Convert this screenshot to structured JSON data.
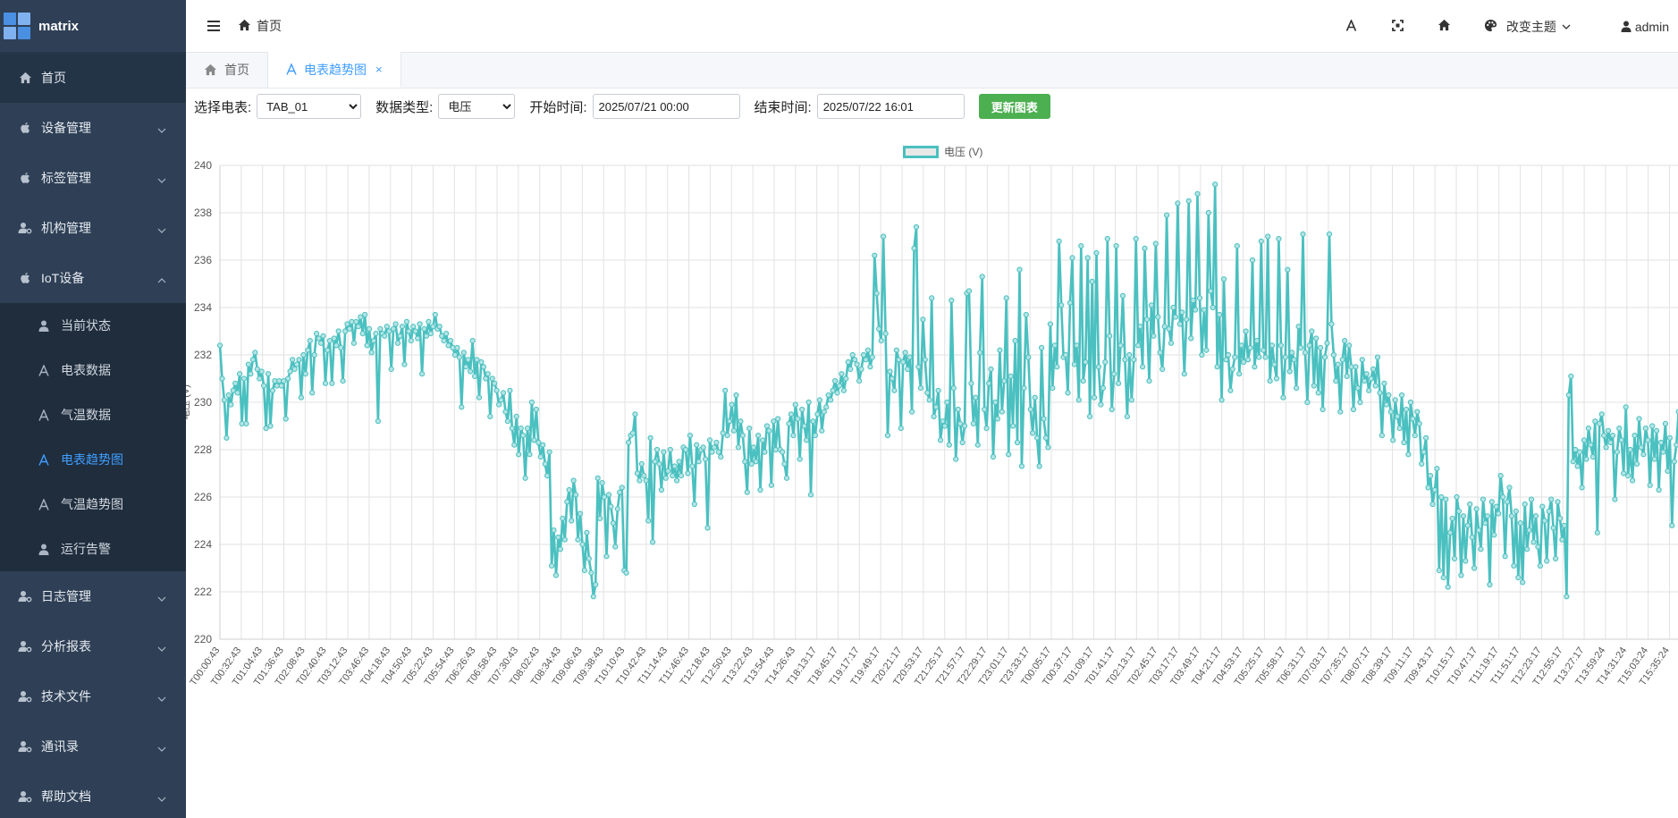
{
  "app": {
    "brand": "matrix"
  },
  "sidebar": {
    "items": [
      {
        "label": "首页",
        "icon": "home-icon"
      },
      {
        "label": "设备管理",
        "icon": "apple-icon"
      },
      {
        "label": "标签管理",
        "icon": "apple-icon"
      },
      {
        "label": "机构管理",
        "icon": "user-gear-icon"
      },
      {
        "label": "IoT设备",
        "icon": "apple-icon"
      },
      {
        "label": "日志管理",
        "icon": "user-gear-icon"
      },
      {
        "label": "分析报表",
        "icon": "user-gear-icon"
      },
      {
        "label": "技术文件",
        "icon": "user-gear-icon"
      },
      {
        "label": "通讯录",
        "icon": "user-gear-icon"
      },
      {
        "label": "帮助文档",
        "icon": "user-gear-icon"
      }
    ],
    "iot_sub": [
      {
        "label": "当前状态",
        "icon": "user-icon"
      },
      {
        "label": "电表数据",
        "icon": "font-icon"
      },
      {
        "label": "气温数据",
        "icon": "font-icon"
      },
      {
        "label": "电表趋势图",
        "icon": "font-icon"
      },
      {
        "label": "气温趋势图",
        "icon": "font-icon"
      },
      {
        "label": "运行告警",
        "icon": "user-icon"
      }
    ]
  },
  "header": {
    "breadcrumb": "首页",
    "theme_label": "改变主题",
    "user": "admin"
  },
  "tabs": [
    {
      "label": "首页"
    },
    {
      "label": "电表趋势图",
      "close": "×"
    }
  ],
  "toolbar": {
    "meter_label": "选择电表:",
    "meter_value": "TAB_01",
    "type_label": "数据类型:",
    "type_value": "电压",
    "start_label": "开始时间:",
    "start_value": "2025/07/21 00:00",
    "end_label": "结束时间:",
    "end_value": "2025/07/22 16:01",
    "update_button": "更新图表"
  },
  "colors": {
    "sidebar_bg": "#2f4056",
    "accent": "#409eff",
    "series": "#4bc0c0",
    "button": "#4caf50"
  },
  "chart_data": {
    "type": "line",
    "legend": "电压 (V)",
    "ylabel": "电压 (V)",
    "ylim": [
      220,
      240
    ],
    "yticks": [
      220,
      222,
      224,
      226,
      228,
      230,
      232,
      234,
      236,
      238,
      240
    ],
    "xticks": [
      "T00:00:43",
      "T00:32:43",
      "T01:04:43",
      "T01:36:43",
      "T02:08:43",
      "T02:40:43",
      "T03:12:43",
      "T03:46:43",
      "T04:18:43",
      "T04:50:43",
      "T05:22:43",
      "T05:54:43",
      "T06:26:43",
      "T06:58:43",
      "T07:30:43",
      "T08:02:43",
      "T08:34:43",
      "T09:06:43",
      "T09:38:43",
      "T10:10:43",
      "T10:42:43",
      "T11:14:43",
      "T11:46:43",
      "T12:18:43",
      "T12:50:43",
      "T13:22:43",
      "T13:54:43",
      "T14:26:43",
      "T18:13:17",
      "T18:45:17",
      "T19:17:17",
      "T19:49:17",
      "T20:21:17",
      "T20:53:17",
      "T21:25:17",
      "T21:57:17",
      "T22:29:17",
      "T23:01:17",
      "T23:33:17",
      "T00:05:17",
      "T00:37:17",
      "T01:09:17",
      "T01:41:17",
      "T02:13:17",
      "T02:45:17",
      "T03:17:17",
      "T03:49:17",
      "T04:21:17",
      "T04:53:17",
      "T05:25:17",
      "T05:58:17",
      "T06:31:17",
      "T07:03:17",
      "T07:35:17",
      "T08:07:17",
      "T08:39:17",
      "T09:11:17",
      "T09:43:17",
      "T10:15:17",
      "T10:47:17",
      "T11:19:17",
      "T11:51:17",
      "T12:23:17",
      "T12:55:17",
      "T13:27:17",
      "T13:59:24",
      "T14:31:24",
      "T15:03:24",
      "T15:35:24"
    ],
    "series": [
      {
        "name": "电压 (V)",
        "values": [
          232.4,
          231.0,
          230.1,
          228.5,
          230.3,
          229.9,
          230.5,
          230.8,
          230.4,
          231.2,
          229.1,
          231.0,
          229.1,
          231.6,
          231.2,
          231.8,
          232.1,
          231.4,
          231.0,
          231.3,
          230.7,
          228.9,
          231.2,
          229.0,
          230.5,
          230.9,
          230.7,
          230.9,
          230.7,
          230.9,
          229.3,
          231.0,
          231.3,
          231.8,
          231.4,
          231.6,
          231.8,
          230.2,
          232.0,
          231.2,
          232.2,
          232.6,
          230.4,
          232.0,
          232.9,
          232.7,
          232.5,
          232.8,
          230.8,
          232.2,
          232.6,
          230.8,
          232.7,
          232.4,
          233.0,
          232.3,
          230.9,
          233.0,
          233.3,
          233.1,
          233.4,
          232.5,
          233.4,
          233.2,
          233.6,
          232.9,
          233.7,
          232.4,
          233.1,
          232.1,
          232.6,
          232.9,
          229.2,
          233.1,
          232.9,
          232.8,
          233.2,
          233.0,
          231.4,
          233.1,
          233.3,
          232.5,
          232.8,
          233.2,
          231.6,
          233.4,
          233.0,
          232.6,
          233.2,
          233.0,
          232.7,
          233.3,
          231.2,
          233.1,
          232.8,
          233.4,
          232.9,
          233.2,
          233.7,
          233.1,
          233.2,
          232.8,
          232.6,
          232.9,
          232.4,
          232.6,
          232.3,
          232.0,
          232.3,
          231.9,
          229.8,
          232.1,
          231.5,
          231.8,
          231.3,
          232.6,
          231.1,
          231.8,
          230.2,
          231.7,
          231.5,
          231.0,
          231.2,
          229.4,
          231.0,
          230.8,
          230.5,
          229.9,
          230.1,
          230.4,
          229.6,
          229.2,
          230.5,
          228.9,
          228.2,
          229.4,
          227.8,
          228.9,
          228.6,
          226.8,
          228.9,
          227.8,
          230.0,
          228.4,
          229.7,
          228.3,
          227.7,
          228.2,
          227.4,
          226.9,
          227.9,
          223.1,
          224.6,
          222.7,
          224.3,
          223.8,
          225.1,
          224.2,
          225.8,
          226.3,
          225.0,
          226.7,
          226.1,
          224.2,
          225.3,
          224.0,
          222.9,
          224.5,
          223.4,
          222.8,
          221.8,
          222.3,
          226.8,
          225.1,
          226.6,
          226.0,
          223.5,
          226.1,
          225.6,
          224.9,
          223.9,
          225.5,
          226.2,
          226.4,
          222.9,
          222.8,
          228.3,
          228.6,
          228.7,
          229.5,
          227.0,
          226.7,
          227.4,
          226.9,
          226.7,
          225.0,
          228.5,
          224.1,
          227.5,
          228.0,
          227.4,
          226.3,
          227.9,
          226.8,
          227.1,
          228.0,
          226.9,
          227.3,
          226.7,
          227.5,
          226.9,
          228.1,
          228.0,
          227.0,
          228.6,
          227.3,
          225.7,
          228.2,
          227.5,
          228.0,
          228.1,
          227.6,
          224.7,
          228.4,
          227.9,
          228.1,
          228.3,
          227.9,
          227.7,
          228.7,
          230.5,
          228.6,
          229.2,
          229.9,
          228.8,
          230.3,
          228.1,
          229.2,
          228.6,
          227.5,
          226.2,
          228.9,
          227.4,
          228.1,
          227.5,
          228.6,
          226.3,
          228.4,
          227.9,
          229.0,
          228.8,
          226.5,
          229.2,
          228.0,
          229.3,
          228.0,
          227.9,
          227.4,
          226.8,
          229.1,
          229.5,
          228.6,
          229.9,
          229.3,
          227.6,
          229.7,
          229.0,
          228.4,
          230.0,
          226.1,
          229.2,
          228.6,
          229.5,
          230.1,
          228.8,
          229.6,
          229.8,
          230.3,
          230.1,
          230.5,
          230.9,
          230.4,
          230.7,
          231.2,
          230.5,
          231.0,
          231.7,
          231.4,
          232.0,
          231.8,
          231.6,
          230.9,
          231.4,
          232.0,
          231.8,
          232.2,
          231.5,
          231.9,
          236.2,
          234.6,
          233.1,
          232.6,
          237.0,
          232.9,
          228.6,
          231.3,
          231.0,
          230.5,
          232.2,
          231.8,
          228.9,
          231.7,
          232.1,
          231.4,
          231.9,
          229.6,
          236.5,
          237.4,
          231.5,
          230.6,
          233.5,
          231.8,
          230.4,
          230.1,
          234.4,
          229.4,
          229.8,
          230.5,
          228.4,
          229.2,
          229.0,
          230.0,
          228.2,
          234.3,
          230.6,
          227.6,
          229.7,
          229.1,
          228.3,
          229.0,
          234.6,
          234.7,
          230.8,
          229.1,
          230.2,
          228.2,
          232.1,
          235.3,
          229.7,
          228.9,
          230.8,
          231.4,
          227.7,
          230.0,
          229.3,
          232.2,
          229.6,
          230.9,
          234.4,
          227.8,
          231.1,
          229.0,
          232.6,
          228.3,
          235.6,
          227.3,
          230.6,
          233.7,
          231.9,
          229.7,
          228.7,
          230.2,
          228.5,
          227.3,
          232.3,
          229.3,
          228.5,
          228.1,
          233.3,
          230.6,
          232.4,
          231.5,
          236.8,
          234.1,
          231.9,
          232.0,
          230.4,
          234.2,
          236.1,
          231.6,
          232.4,
          230.1,
          236.6,
          230.9,
          231.7,
          236.1,
          229.4,
          235.1,
          230.2,
          236.3,
          231.5,
          229.9,
          230.6,
          231.7,
          236.9,
          232.8,
          229.7,
          231.2,
          236.6,
          230.8,
          232.4,
          234.5,
          231.8,
          229.4,
          232.0,
          230.1,
          231.8,
          236.9,
          232.4,
          233.2,
          231.5,
          236.5,
          233.5,
          230.9,
          234.1,
          232.8,
          236.7,
          233.6,
          232.1,
          231.4,
          233.2,
          237.9,
          233.1,
          232.5,
          234.0,
          233.6,
          238.4,
          233.3,
          233.8,
          231.2,
          233.5,
          238.5,
          232.7,
          234.3,
          233.9,
          238.8,
          234.4,
          232.0,
          233.9,
          232.2,
          238.0,
          234.7,
          234.0,
          239.2,
          231.5,
          233.7,
          230.1,
          235.2,
          231.8,
          232.0,
          230.5,
          231.4,
          231.9,
          236.6,
          231.2,
          232.4,
          231.7,
          233.0,
          231.8,
          232.3,
          236.0,
          231.5,
          232.6,
          231.9,
          236.8,
          232.2,
          231.9,
          237.0,
          230.9,
          232.4,
          231.6,
          231.0,
          236.9,
          232.4,
          230.2,
          231.9,
          235.6,
          231.3,
          232.1,
          231.8,
          230.6,
          233.2,
          232.3,
          237.1,
          232.1,
          230.0,
          232.4,
          233.0,
          230.7,
          232.7,
          230.4,
          232.3,
          229.7,
          231.9,
          232.5,
          237.1,
          233.3,
          232.0,
          230.9,
          231.6,
          229.6,
          231.8,
          232.6,
          231.1,
          232.4,
          231.5,
          229.7,
          231.5,
          230.6,
          230.0,
          231.8,
          230.9,
          231.2,
          230.5,
          231.0,
          231.4,
          230.7,
          231.9,
          230.4,
          228.6,
          230.8,
          229.9,
          230.3,
          229.6,
          228.4,
          230.1,
          229.4,
          228.9,
          230.3,
          228.3,
          229.7,
          227.8,
          230.0,
          229.3,
          228.6,
          229.6,
          229.1,
          227.4,
          227.9,
          228.5,
          226.4,
          226.9,
          225.7,
          226.3,
          227.2,
          222.9,
          226.0,
          222.6,
          225.9,
          222.2,
          224.5,
          225.1,
          223.4,
          226.0,
          225.4,
          222.7,
          225.2,
          223.3,
          224.8,
          225.7,
          224.3,
          223.0,
          225.5,
          224.6,
          223.8,
          225.9,
          224.9,
          225.2,
          222.3,
          225.8,
          224.4,
          225.6,
          225.3,
          226.9,
          226.0,
          223.5,
          225.8,
          226.4,
          225.2,
          223.1,
          225.4,
          222.6,
          224.9,
          222.4,
          225.7,
          223.8,
          224.6,
          225.9,
          224.1,
          225.2,
          223.9,
          223.1,
          225.6,
          225.0,
          223.3,
          225.4,
          225.9,
          224.7,
          223.4,
          225.8,
          225.1,
          224.2,
          224.8,
          221.8,
          230.3,
          231.1,
          227.5,
          228.0,
          227.3,
          227.9,
          226.4,
          228.4,
          227.6,
          228.9,
          228.2,
          227.7,
          229.2,
          224.5,
          229.1,
          229.5,
          228.6,
          228.1,
          228.8,
          228.3,
          228.6,
          225.9,
          227.9,
          228.9,
          228.4,
          227.0,
          229.8,
          226.9,
          228.0,
          226.7,
          228.6,
          227.4,
          229.3,
          228.1,
          227.8,
          228.9,
          228.4,
          226.5,
          229.0,
          227.6,
          228.8,
          226.3,
          228.3,
          227.9,
          229.1,
          227.1,
          228.5,
          224.8,
          227.5,
          228.2,
          229.6,
          228.7,
          230.0,
          228.9,
          233.5,
          227.0,
          229.8,
          228.4,
          229.6,
          228.8,
          233.5,
          228.3,
          227.9,
          226.4,
          228.6,
          228.1,
          226.2
        ]
      }
    ]
  }
}
